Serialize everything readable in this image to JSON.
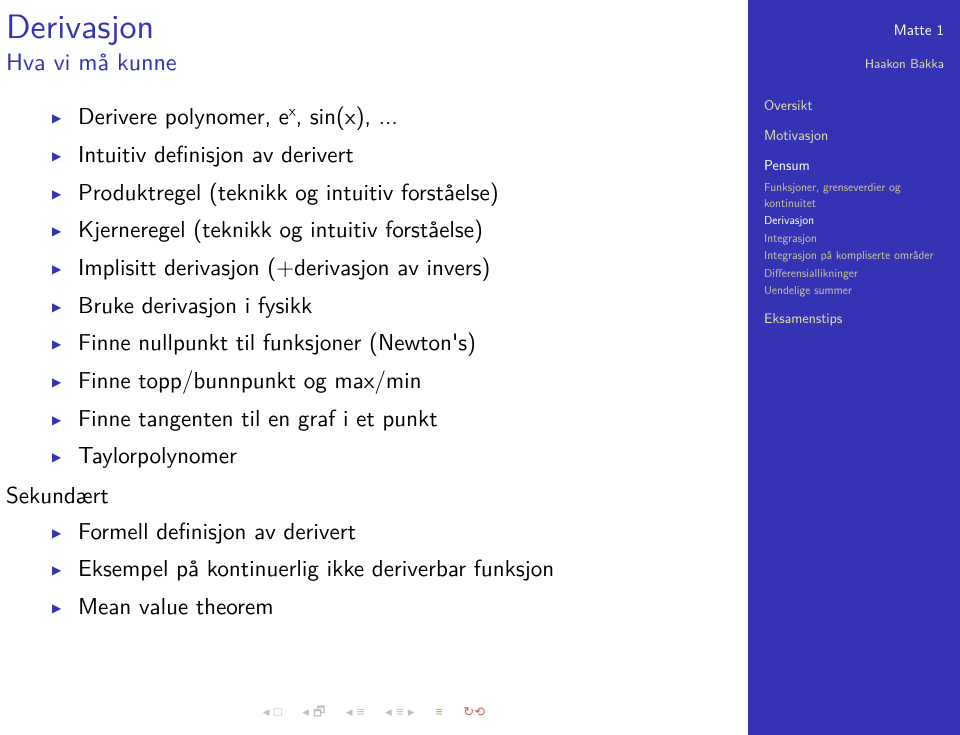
{
  "title": "Derivasjon",
  "subtitle": "Hva vi må kunne",
  "itemsPrimary": [
    "Derivere polynomer, eˣ, sin(x), ...",
    "Intuitiv definisjon av derivert",
    "Produktregel (teknikk og intuitiv forståelse)",
    "Kjerneregel (teknikk og intuitiv forståelse)",
    "Implisitt derivasjon (+derivasjon av invers)",
    "Bruke derivasjon i fysikk",
    "Finne nullpunkt til funksjoner (Newton's)",
    "Finne topp/bunnpunkt og max/min",
    "Finne tangenten til en graf i et punkt",
    "Taylorpolynomer"
  ],
  "secondaryLabel": "Sekundært",
  "itemsSecondary": [
    "Formell definisjon av derivert",
    "Eksempel på kontinuerlig ikke deriverbar funksjon",
    "Mean value theorem"
  ],
  "sidebar": {
    "course": "Matte 1",
    "author": "Haakon Bakka",
    "sections": [
      {
        "label": "Oversikt",
        "current": false
      },
      {
        "label": "Motivasjon",
        "current": false
      },
      {
        "label": "Pensum",
        "current": true
      },
      {
        "label": "Eksamenstips",
        "current": false
      }
    ],
    "pensumSubs": [
      {
        "label": "Funksjoner, grenseverdier og kontinuitet",
        "current": false
      },
      {
        "label": "Derivasjon",
        "current": true
      },
      {
        "label": "Integrasjon",
        "current": false
      },
      {
        "label": "Integrasjon på kompliserte områder",
        "current": false
      },
      {
        "label": "Differensiallikninger",
        "current": false
      },
      {
        "label": "Uendelige summer",
        "current": false
      }
    ]
  }
}
